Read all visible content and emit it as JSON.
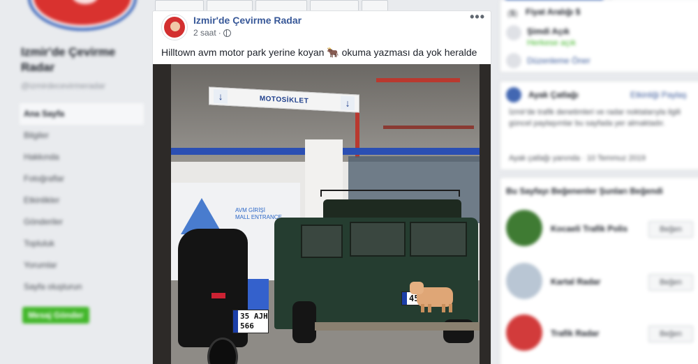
{
  "left_sidebar": {
    "page_name": "Izmir'de Çevirme Radar",
    "page_handle": "@izmirdecevirmeradar",
    "nav_items": [
      "Ana Sayfa",
      "Bilgiler",
      "Hakkında",
      "Fotoğraflar",
      "Etkinlikler",
      "Gönderiler",
      "Topluluk",
      "Yorumlar",
      "Sayfa oluşturun"
    ],
    "cta_label": "Mesaj Gönder"
  },
  "post": {
    "author": "Izmir'de Çevirme Radar",
    "time": "2 saat",
    "more_label": "•••",
    "text": "Hilltown avm motor park yerine koyan 🐂 okuma yazması da yok heralde",
    "photo": {
      "sign_text": "MOTOSİKLET",
      "entrance_tr": "AVM GİRİŞİ",
      "entrance_en": "MALL ENTRANCE",
      "car_plate": "45 H",
      "moto_plate_line1": "35 AJH",
      "moto_plate_line2": "566"
    }
  },
  "right_column": {
    "info_rows": [
      {
        "label": "Fiyat Aralığı $"
      },
      {
        "label": "Şimdi Açık",
        "sub": "Herkese açık"
      },
      {
        "label": "Düzenleme Öner"
      }
    ],
    "event_card": {
      "title": "Ayak Çatlağı",
      "action": "Etkinliği Paylaş",
      "body": "İzmir'de trafik denetimleri ve radar noktalarıyla ilgili güncel paylaşımlar bu sayfada yer almaktadır.",
      "footer": "Ayak çatlağı yanında · 10 Temmuz 2019"
    },
    "suggested": {
      "title": "Bu Sayfayı Beğenenler Şunları Beğendi",
      "pages": [
        {
          "name": "Kocaeli Trafik Polis",
          "button": "Beğen"
        },
        {
          "name": "Kartal Radar",
          "button": "Beğen"
        },
        {
          "name": "Trafik Radar",
          "button": "Beğen"
        }
      ]
    }
  }
}
